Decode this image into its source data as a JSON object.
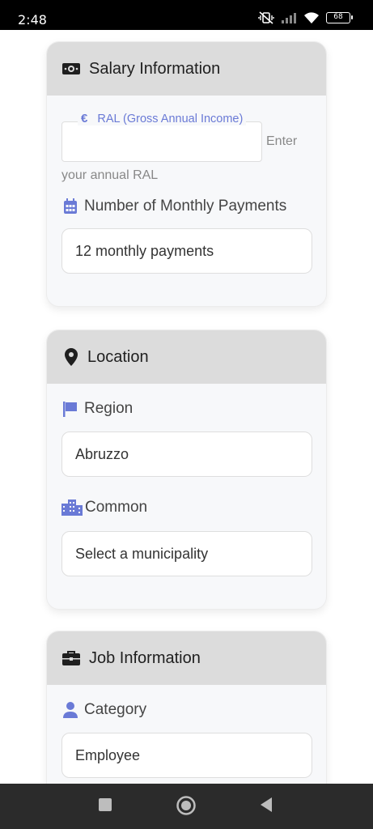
{
  "status_bar": {
    "time": "2:48",
    "battery": "68"
  },
  "salary": {
    "title": "Salary Information",
    "ral_label": "RAL (Gross Annual Income)",
    "ral_currency": "€",
    "ral_value": "",
    "ral_help_1": "Enter",
    "ral_help_2": "your annual RAL",
    "payments_label": "Number of Monthly Payments",
    "payments_value": "12 monthly payments"
  },
  "location": {
    "title": "Location",
    "region_label": "Region",
    "region_value": "Abruzzo",
    "common_label": "Common",
    "common_value": "Select a municipality"
  },
  "job": {
    "title": "Job Information",
    "category_label": "Category",
    "category_value": "Employee"
  },
  "colors": {
    "accent": "#6a7ad6",
    "header_bg": "#dcdcdc",
    "card_bg": "#f7f8fa"
  },
  "icons": [
    "money-icon",
    "calendar-icon",
    "map-pin-icon",
    "flag-icon",
    "city-icon",
    "briefcase-icon",
    "user-icon"
  ]
}
